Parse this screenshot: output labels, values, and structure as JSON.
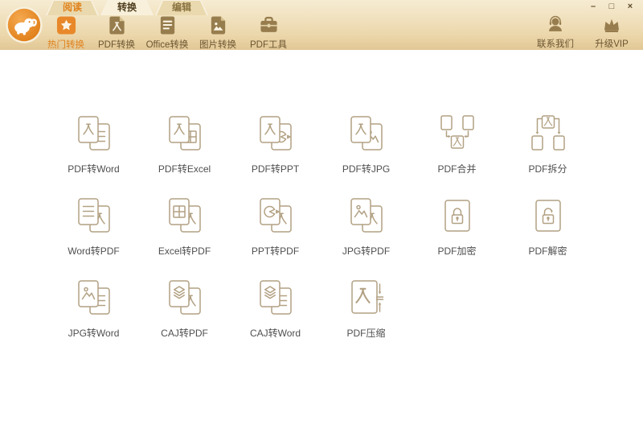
{
  "window": {
    "controls": [
      {
        "id": "minimize",
        "glyph": "–"
      },
      {
        "id": "maximize",
        "glyph": "□"
      },
      {
        "id": "close",
        "glyph": "×"
      }
    ]
  },
  "tabs": [
    {
      "id": "read",
      "label": "阅读",
      "active": false,
      "color": "#e0821c"
    },
    {
      "id": "convert",
      "label": "转换",
      "active": true,
      "color": "#4f3d1f"
    },
    {
      "id": "edit",
      "label": "编辑",
      "active": false,
      "color": "#8a7340"
    }
  ],
  "toolbar": {
    "items": [
      {
        "id": "hot-convert",
        "label": "热门转换",
        "icon": "star-icon",
        "active": true
      },
      {
        "id": "pdf-convert",
        "label": "PDF转换",
        "icon": "pdf-document-icon",
        "active": false
      },
      {
        "id": "office-convert",
        "label": "Office转换",
        "icon": "office-document-icon",
        "active": false
      },
      {
        "id": "image-convert",
        "label": "图片转换",
        "icon": "image-document-icon",
        "active": false
      },
      {
        "id": "pdf-tools",
        "label": "PDF工具",
        "icon": "toolbox-icon",
        "active": false
      }
    ],
    "right": [
      {
        "id": "contact-us",
        "label": "联系我们",
        "icon": "headset-icon"
      },
      {
        "id": "upgrade-vip",
        "label": "升级VIP",
        "icon": "crown-icon"
      }
    ]
  },
  "grid": {
    "items": [
      {
        "id": "pdf-to-word",
        "label": "PDF转Word"
      },
      {
        "id": "pdf-to-excel",
        "label": "PDF转Excel"
      },
      {
        "id": "pdf-to-ppt",
        "label": "PDF转PPT"
      },
      {
        "id": "pdf-to-jpg",
        "label": "PDF转JPG"
      },
      {
        "id": "pdf-merge",
        "label": "PDF合并"
      },
      {
        "id": "pdf-split",
        "label": "PDF拆分"
      },
      {
        "id": "word-to-pdf",
        "label": "Word转PDF"
      },
      {
        "id": "excel-to-pdf",
        "label": "Excel转PDF"
      },
      {
        "id": "ppt-to-pdf",
        "label": "PPT转PDF"
      },
      {
        "id": "jpg-to-pdf",
        "label": "JPG转PDF"
      },
      {
        "id": "pdf-encrypt",
        "label": "PDF加密"
      },
      {
        "id": "pdf-decrypt",
        "label": "PDF解密"
      },
      {
        "id": "jpg-to-word",
        "label": "JPG转Word"
      },
      {
        "id": "caj-to-pdf",
        "label": "CAJ转PDF"
      },
      {
        "id": "caj-to-word",
        "label": "CAJ转Word"
      },
      {
        "id": "pdf-compress",
        "label": "PDF压缩"
      }
    ]
  },
  "colors": {
    "header_top": "#f6ecd3",
    "header_bottom": "#e2c795",
    "header_border": "#d8bd8c",
    "orange": "#e8882a",
    "orange_text": "#e0821c",
    "brown": "#977d4e",
    "brown_light": "#d9c391",
    "toolbar_text": "#6b5530",
    "tab_active_bg": "#f8f0da",
    "tab_inactive_bg": "#ead9ae",
    "icon_stroke": "#b2a183",
    "label_text": "#4f4f4f",
    "content_bg": "#ffffff",
    "window_ctrl": "#5d4a28",
    "glyph_white": "#fcf5e6"
  }
}
